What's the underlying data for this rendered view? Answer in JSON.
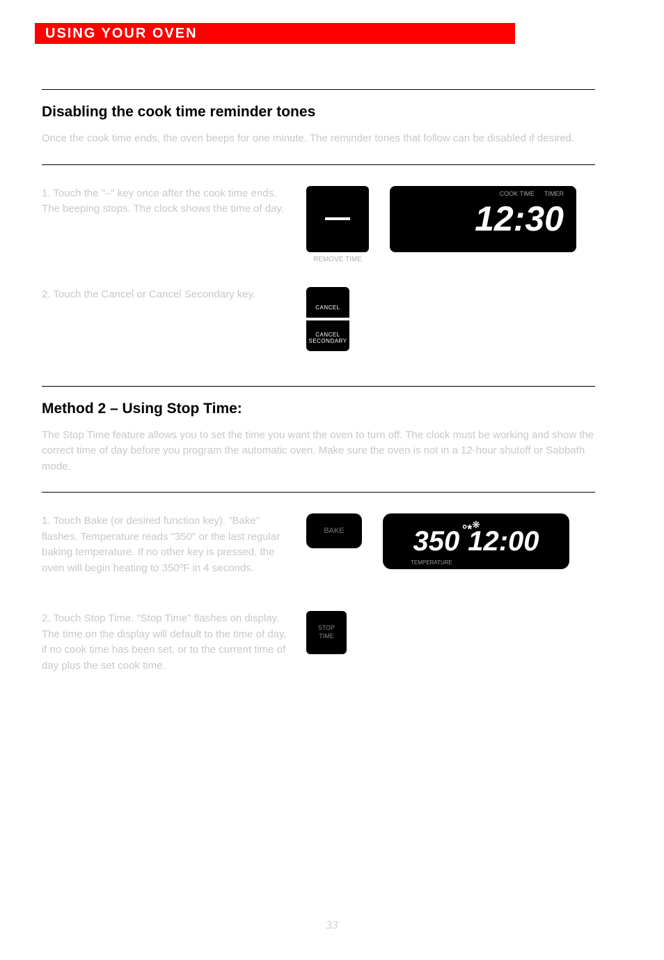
{
  "header": {
    "title": "USING YOUR OVEN"
  },
  "section1": {
    "title": "Disabling the cook time reminder tones",
    "desc": "Once the cook time ends, the oven beeps for one minute. The reminder tones that follow can be disabled if desired."
  },
  "steps_a": [
    {
      "num": "1.",
      "text": "Touch the \"–\" key once after the cook time ends. The beeping stops. The clock shows the time of day.",
      "display": "12:30",
      "display_label1": "COOK TIME",
      "display_label2": "TIMER",
      "btn_label": "REMOVE TIME"
    },
    {
      "num": "2.",
      "text": "Touch the Cancel or Cancel Secondary key.",
      "btn_top": "CANCEL",
      "btn_bottom": "CANCEL SECONDARY"
    }
  ],
  "section2": {
    "title": "Method 2 – Using Stop Time:",
    "desc": "The Stop Time feature allows you to set the time you want the oven to turn off. The clock must be working and show the correct time of day before you program the automatic oven. Make sure the oven is not in a 12-hour shutoff or Sabbath mode."
  },
  "steps_b": [
    {
      "num": "1.",
      "text": "Touch Bake (or desired function key). \"Bake\" flashes. Temperature reads \"350\" or the last regular baking temperature. If no other key is pressed, the oven will begin heating to 350ºF in 4 seconds.",
      "btn_label": "BAKE",
      "temp": "350",
      "time": "12:00",
      "temp_label": "TEMPERATURE"
    },
    {
      "num": "2.",
      "text": "Touch Stop Time. \"Stop Time\" flashes on display. The time on the display will default to the time of day, if no cook time has been set, or to the current time of day plus the set cook time.",
      "btn_label": "STOP\nTIME"
    }
  ],
  "page_number": "33"
}
